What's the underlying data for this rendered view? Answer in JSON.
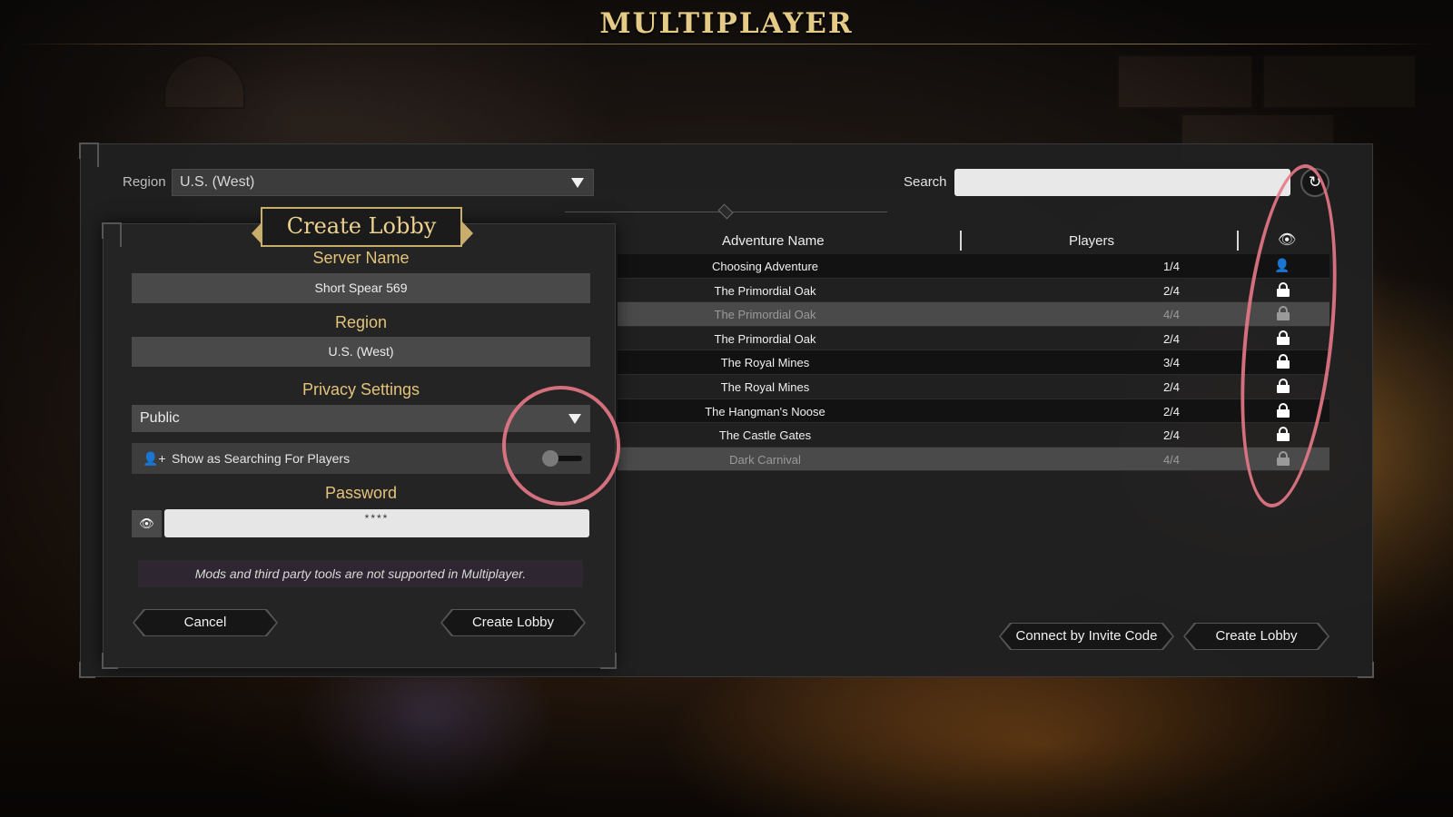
{
  "title": "MULTIPLAYER",
  "toolbar": {
    "region_label": "Region",
    "region_value": "U.S. (West)",
    "search_label": "Search",
    "search_value": "",
    "refresh_icon": "refresh-icon"
  },
  "table": {
    "headers": {
      "name": "Adventure Name",
      "players": "Players",
      "status_icon": "eye-icon"
    },
    "rows": [
      {
        "name": "Choosing Adventure",
        "players": "1/4",
        "icon": "add-user-icon",
        "state": "open"
      },
      {
        "name": "The Primordial Oak",
        "players": "2/4",
        "icon": "lock-icon",
        "state": "open"
      },
      {
        "name": "The Primordial Oak",
        "players": "4/4",
        "icon": "lock-icon",
        "state": "full"
      },
      {
        "name": "The Primordial Oak",
        "players": "2/4",
        "icon": "lock-icon",
        "state": "open"
      },
      {
        "name": "The Royal Mines",
        "players": "3/4",
        "icon": "lock-icon",
        "state": "open"
      },
      {
        "name": "The Royal Mines",
        "players": "2/4",
        "icon": "lock-icon",
        "state": "open"
      },
      {
        "name": "The Hangman's Noose",
        "players": "2/4",
        "icon": "lock-icon",
        "state": "open"
      },
      {
        "name": "The Castle Gates",
        "players": "2/4",
        "icon": "lock-icon",
        "state": "open"
      },
      {
        "name": "Dark Carnival",
        "players": "4/4",
        "icon": "lock-icon",
        "state": "full"
      }
    ]
  },
  "lobby": {
    "title": "Create Lobby",
    "server_name_label": "Server Name",
    "server_name_value": "Short Spear 569",
    "region_label": "Region",
    "region_value": "U.S. (West)",
    "privacy_label": "Privacy Settings",
    "privacy_value": "Public",
    "searching_label": "Show as Searching For Players",
    "searching_enabled": false,
    "password_label": "Password",
    "password_value": "****",
    "warning": "Mods and third party tools are not supported in Multiplayer.",
    "cancel_label": "Cancel",
    "create_label": "Create Lobby"
  },
  "footer": {
    "invite_label": "Connect by Invite Code",
    "create_label": "Create Lobby"
  },
  "colors": {
    "gold": "#e6cb86",
    "annotation": "#e87887",
    "panel": "#202021"
  }
}
